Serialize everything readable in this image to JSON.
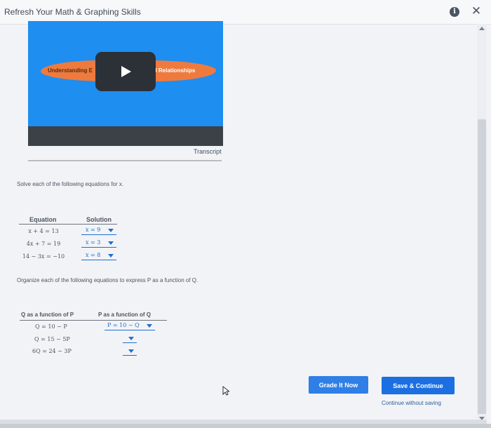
{
  "window": {
    "title": "Refresh Your Math & Graphing Skills",
    "info_icon": "info-icon",
    "close_icon": "close-icon",
    "close_glyph": "✕",
    "info_glyph": "i"
  },
  "video": {
    "banner_left": "Understanding E",
    "banner_right": "al Relationships",
    "play_icon": "play-icon",
    "transcript_label": "Transcript"
  },
  "equations_section": {
    "prompt": "Solve each of the following equations for x.",
    "headers": {
      "equation": "Equation",
      "solution": "Solution"
    },
    "rows": [
      {
        "equation": "x + 4 = 13",
        "solution": "x = 9"
      },
      {
        "equation": "4x + 7 = 19",
        "solution": "x = 3"
      },
      {
        "equation": "14 − 3x = −10",
        "solution": "x = 8"
      }
    ]
  },
  "functions_section": {
    "prompt": "Organize each of the following equations to express P as a function of Q.",
    "headers": {
      "q_of_p": "Q as a function of P",
      "p_of_q": "P as a function of Q"
    },
    "rows": [
      {
        "q_of_p": "Q = 10 − P",
        "p_of_q": "P = 10 − Q"
      },
      {
        "q_of_p": "Q = 15 − 5P",
        "p_of_q": ""
      },
      {
        "q_of_p": "6Q = 24 − 3P",
        "p_of_q": ""
      }
    ]
  },
  "actions": {
    "grade_label": "Grade It Now",
    "save_label": "Save & Continue",
    "continue_label": "Continue without saving"
  },
  "colors": {
    "accent": "#1c6fe0",
    "video_bg": "#1e8ef0",
    "banner": "#ef7a3d"
  }
}
